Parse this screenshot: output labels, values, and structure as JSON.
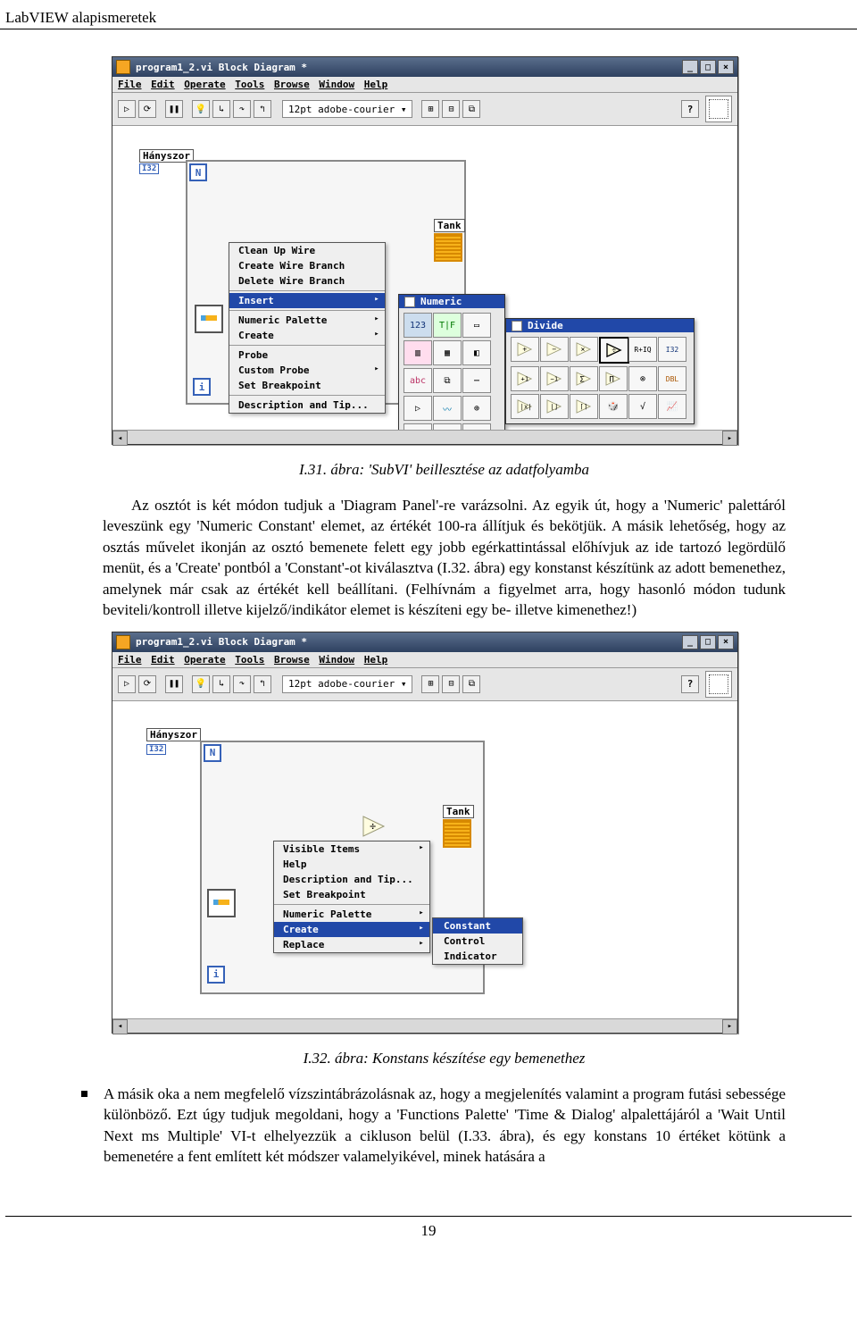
{
  "doc": {
    "header": "LabVIEW alapismeretek",
    "page_number": "19"
  },
  "fig1": {
    "caption": "I.31. ábra: 'SubVI' beillesztése az adatfolyamba",
    "window_title": "program1_2.vi Block Diagram *",
    "menu": {
      "file": "File",
      "edit": "Edit",
      "operate": "Operate",
      "tools": "Tools",
      "browse": "Browse",
      "window": "Window",
      "help": "Help"
    },
    "toolbar": {
      "font": "12pt adobe-courier"
    },
    "labels": {
      "hanyszor": "Hányszor",
      "i32": "I32",
      "n": "N",
      "i": "i",
      "tank": "Tank"
    },
    "context": {
      "clean": "Clean Up Wire",
      "create_branch": "Create Wire Branch",
      "delete_branch": "Delete Wire Branch",
      "insert": "Insert",
      "numeric_palette": "Numeric Palette",
      "create": "Create",
      "probe": "Probe",
      "custom_probe": "Custom Probe",
      "set_breakpoint": "Set Breakpoint",
      "desc_tip": "Description and Tip..."
    },
    "palette_numeric": {
      "title": "Numeric"
    },
    "palette_divide": {
      "title": "Divide",
      "i32": "I32",
      "dbl": "DBL",
      "riq": "R+IQ"
    }
  },
  "para1": "Az osztót is két módon tudjuk a 'Diagram Panel'-re varázsolni. Az egyik út, hogy a 'Numeric' palettáról leveszünk egy 'Numeric Constant' elemet, az értékét 100-ra állítjuk és bekötjük. A másik lehetőség, hogy az osztás művelet ikonján az osztó bemenete felett egy jobb egérkattintással előhívjuk az ide tartozó legördülő menüt, és a 'Create' pontból a 'Constant'-ot kiválasztva (I.32. ábra) egy konstanst készítünk az adott bemenethez, amelynek már csak az értékét kell beállítani. (Felhívnám a figyelmet arra, hogy hasonló módon tudunk beviteli/kontroll illetve kijelző/indikátor elemet is készíteni egy be- illetve kimenethez!)",
  "fig2": {
    "caption": "I.32. ábra: Konstans készítése egy bemenethez",
    "window_title": "program1_2.vi Block Diagram *",
    "menu": {
      "file": "File",
      "edit": "Edit",
      "operate": "Operate",
      "tools": "Tools",
      "browse": "Browse",
      "window": "Window",
      "help": "Help"
    },
    "toolbar": {
      "font": "12pt adobe-courier"
    },
    "labels": {
      "hanyszor": "Hányszor",
      "i32": "I32",
      "n": "N",
      "i": "i",
      "tank": "Tank"
    },
    "context": {
      "visible": "Visible Items",
      "help": "Help",
      "desc_tip": "Description and Tip...",
      "set_breakpoint": "Set Breakpoint",
      "numeric_palette": "Numeric Palette",
      "create": "Create",
      "replace": "Replace"
    },
    "create_sub": {
      "constant": "Constant",
      "control": "Control",
      "indicator": "Indicator"
    }
  },
  "para2": "A másik oka a nem megfelelő vízszintábrázolásnak az, hogy a megjelenítés valamint a program futási sebessége különböző. Ezt úgy tudjuk megoldani, hogy a 'Functions Palette' 'Time & Dialog' alpalettájáról a 'Wait Until Next ms Multiple' VI-t elhelyezzük a cikluson belül (I.33. ábra), és egy konstans 10 értéket kötünk a bemenetére a fent említett két módszer valamelyikével,  minek hatására a"
}
